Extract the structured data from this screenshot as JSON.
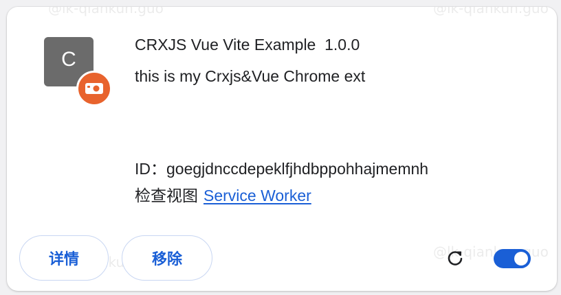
{
  "extension": {
    "icon_letter": "C",
    "title": "CRXJS Vue Vite Example  1.0.0",
    "description": "this is my Crxjs&Vue Chrome ext",
    "id_label": "ID：",
    "id_value": "goegjdnccdepeklfjhdbppohhajmemnh",
    "inspect_label": "检查视图",
    "inspect_link": "Service Worker"
  },
  "actions": {
    "details_label": "详情",
    "remove_label": "移除",
    "reload_icon": "reload-icon",
    "enabled": true
  },
  "watermark": {
    "text": "@lk-qiankun.guo"
  },
  "colors": {
    "accent": "#1a5fd6",
    "badge": "#e8632d",
    "icon_bg": "#6b6b6b"
  }
}
